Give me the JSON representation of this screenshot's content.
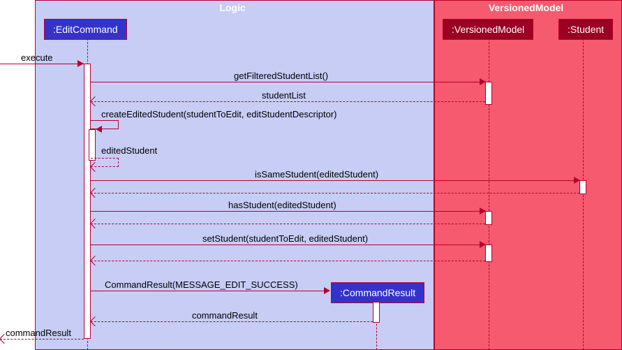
{
  "chart_data": {
    "type": "sequence-diagram",
    "frames": [
      {
        "name": "Logic",
        "participants": [
          ":EditCommand",
          ":CommandResult"
        ]
      },
      {
        "name": "VersionedModel",
        "participants": [
          ":VersionedModel",
          ":Student"
        ]
      }
    ],
    "messages": [
      {
        "from": "caller",
        "to": ":EditCommand",
        "label": "execute",
        "type": "call"
      },
      {
        "from": ":EditCommand",
        "to": ":VersionedModel",
        "label": "getFilteredStudentList()",
        "type": "call"
      },
      {
        "from": ":VersionedModel",
        "to": ":EditCommand",
        "label": "studentList",
        "type": "return"
      },
      {
        "from": ":EditCommand",
        "to": ":EditCommand",
        "label": "createEditedStudent(studentToEdit, editStudentDescriptor)",
        "type": "self-call"
      },
      {
        "from": ":EditCommand",
        "to": ":EditCommand",
        "label": "editedStudent",
        "type": "self-return"
      },
      {
        "from": ":EditCommand",
        "to": ":Student",
        "label": "isSameStudent(editedStudent)",
        "type": "call"
      },
      {
        "from": ":Student",
        "to": ":EditCommand",
        "label": "",
        "type": "return"
      },
      {
        "from": ":EditCommand",
        "to": ":VersionedModel",
        "label": "hasStudent(editedStudent)",
        "type": "call"
      },
      {
        "from": ":VersionedModel",
        "to": ":EditCommand",
        "label": "",
        "type": "return"
      },
      {
        "from": ":EditCommand",
        "to": ":VersionedModel",
        "label": "setStudent(studentToEdit, editedStudent)",
        "type": "call"
      },
      {
        "from": ":VersionedModel",
        "to": ":EditCommand",
        "label": "",
        "type": "return"
      },
      {
        "from": ":EditCommand",
        "to": ":CommandResult",
        "label": "CommandResult(MESSAGE_EDIT_SUCCESS)",
        "type": "create"
      },
      {
        "from": ":CommandResult",
        "to": ":EditCommand",
        "label": "commandResult",
        "type": "return"
      },
      {
        "from": ":EditCommand",
        "to": "caller",
        "label": "commandResult",
        "type": "return"
      }
    ]
  },
  "frames": {
    "logic": "Logic",
    "versionedModel": "VersionedModel"
  },
  "participants": {
    "editCommand": ":EditCommand",
    "commandResult": ":CommandResult",
    "versionedModel": ":VersionedModel",
    "student": ":Student"
  },
  "labels": {
    "execute": "execute",
    "getFilteredStudentList": "getFilteredStudentList()",
    "studentList": "studentList",
    "createEditedStudent": "createEditedStudent(studentToEdit, editStudentDescriptor)",
    "editedStudent": "editedStudent",
    "isSameStudent": "isSameStudent(editedStudent)",
    "hasStudent": "hasStudent(editedStudent)",
    "setStudent": "setStudent(studentToEdit, editedStudent)",
    "commandResultMsg": "CommandResult(MESSAGE_EDIT_SUCCESS)",
    "commandResultReturn": "commandResult",
    "finalReturn": "commandResult"
  }
}
